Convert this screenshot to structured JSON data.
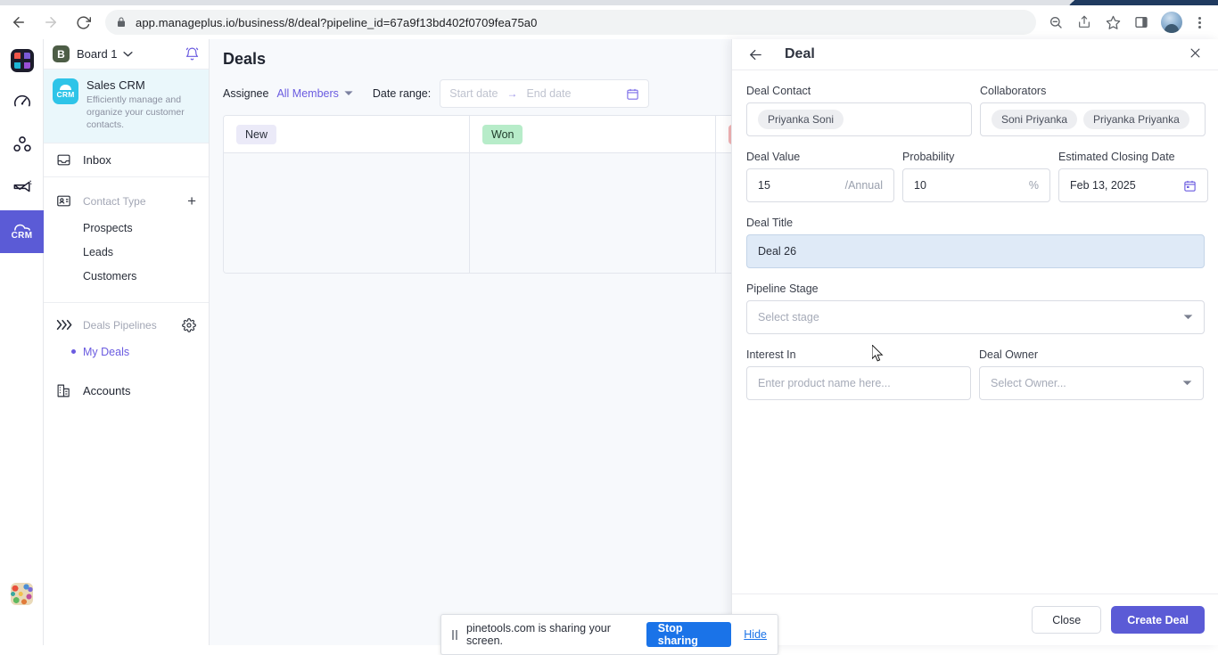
{
  "browser": {
    "url": "app.manageplus.io/business/8/deal?pipeline_id=67a9f13bd402f0709fea75a0",
    "back_icon": "back-arrow-icon",
    "forward_icon": "forward-arrow-icon",
    "reload_icon": "reload-icon",
    "lock_icon": "lock-icon",
    "zoom_icon": "zoom-out-icon",
    "share_icon": "share-icon",
    "bookmark_icon": "star-icon",
    "sidepanel_icon": "side-panel-icon",
    "profile_icon": "profile-avatar",
    "menu_icon": "kebab-menu-icon"
  },
  "rail": {
    "logo_name": "app-logo",
    "items": [
      {
        "name": "dashboard",
        "icon": "speedometer-icon",
        "active": false
      },
      {
        "name": "team",
        "icon": "group-icon",
        "active": false
      },
      {
        "name": "campaigns",
        "icon": "campaign-mail-icon",
        "active": false
      },
      {
        "name": "crm",
        "icon": "crm-cloud-icon",
        "label": "CRM",
        "active": true
      }
    ],
    "user_avatar": "user-avatar"
  },
  "sidebar": {
    "board": {
      "badge": "B",
      "name": "Board 1",
      "caret": "chevron-down-icon",
      "bell": "bell-icon"
    },
    "app_card": {
      "icon_label": "CRM",
      "title": "Sales CRM",
      "description": "Efficiently manage and organize your customer contacts."
    },
    "inbox": {
      "label": "Inbox",
      "icon": "inbox-icon"
    },
    "contact_type": {
      "label": "Contact Type",
      "icon": "contact-card-icon",
      "add": "+",
      "items": [
        "Prospects",
        "Leads",
        "Customers"
      ]
    },
    "deals_pipelines": {
      "label": "Deals Pipelines",
      "icon": "pipeline-chevrons-icon",
      "settings": "gear-icon",
      "items": [
        {
          "label": "My Deals",
          "active": true
        }
      ]
    },
    "accounts": {
      "label": "Accounts",
      "icon": "building-icon"
    }
  },
  "main": {
    "title": "Deals",
    "filters": {
      "assignee_label": "Assignee",
      "assignee_value": "All Members",
      "date_range_label": "Date range:",
      "start_placeholder": "Start date",
      "end_placeholder": "End date",
      "range_arrow": "→",
      "calendar_icon": "calendar-icon"
    },
    "board_columns": [
      {
        "label": "New",
        "bg": "#ebeaf8",
        "fg": "#2a2f3a"
      },
      {
        "label": "Won",
        "bg": "#b7ecc9",
        "fg": "#1f3a2a"
      },
      {
        "label": "",
        "bg": "#f3b4b4",
        "fg": "#4a2020"
      }
    ]
  },
  "deal_panel": {
    "back_icon": "back-arrow-icon",
    "title": "Deal",
    "close_icon": "close-icon",
    "deal_contact": {
      "label": "Deal Contact",
      "chips": [
        "Priyanka Soni"
      ]
    },
    "collaborators": {
      "label": "Collaborators",
      "chips": [
        "Soni Priyanka",
        "Priyanka Priyanka"
      ]
    },
    "deal_value": {
      "label": "Deal Value",
      "value": "15",
      "suffix": "/Annual"
    },
    "probability": {
      "label": "Probability",
      "value": "10",
      "suffix": "%"
    },
    "closing_date": {
      "label": "Estimated Closing Date",
      "value": "Feb 13, 2025",
      "icon": "calendar-icon"
    },
    "deal_title": {
      "label": "Deal Title",
      "value": "Deal 26"
    },
    "pipeline_stage": {
      "label": "Pipeline Stage",
      "placeholder": "Select stage",
      "caret": "chevron-down-icon"
    },
    "interest_in": {
      "label": "Interest In",
      "placeholder": "Enter product name here..."
    },
    "deal_owner": {
      "label": "Deal Owner",
      "placeholder": "Select Owner...",
      "caret": "chevron-down-icon"
    },
    "footer": {
      "close": "Close",
      "create": "Create Deal"
    }
  },
  "share_bar": {
    "pause_icon": "pause-icon",
    "message": "pinetools.com is sharing your screen.",
    "stop_label": "Stop sharing",
    "hide_label": "Hide"
  },
  "colors": {
    "accent_purple": "#5b5bd6",
    "link_purple": "#6a5be0",
    "chrome_blue": "#1a73e8",
    "crm_cyan": "#2ec4e8",
    "focus_blue": "#dfeaf7"
  }
}
